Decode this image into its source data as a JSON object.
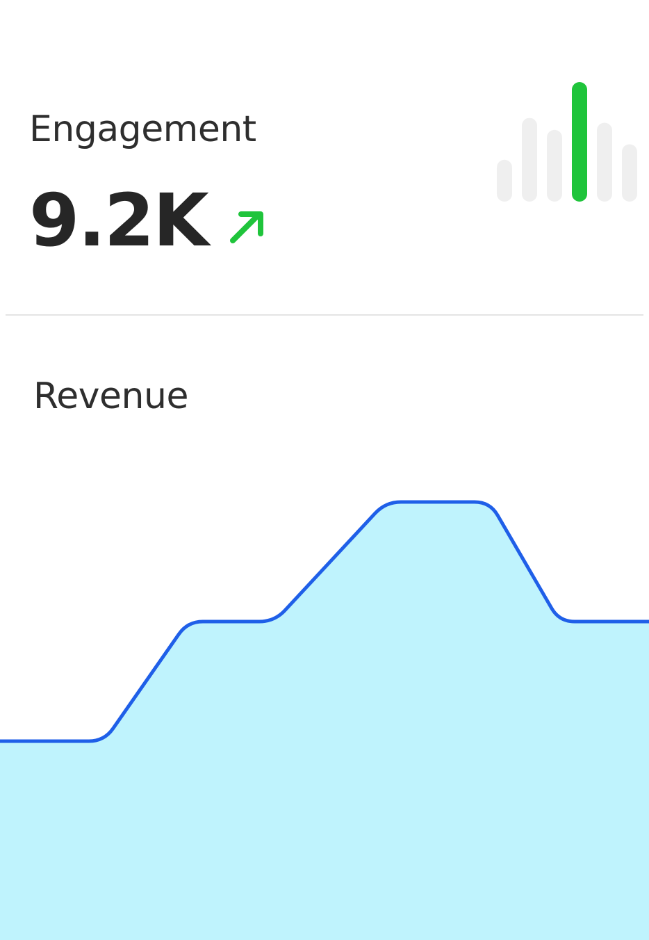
{
  "engagement": {
    "label": "Engagement",
    "value": "9.2K",
    "trend_icon": "arrow-up-right-icon",
    "trend_color": "#1fc43b"
  },
  "sparkline": {
    "bars": [
      0.35,
      0.7,
      0.6,
      1.0,
      0.66,
      0.48
    ],
    "highlight_index": 3,
    "base_color": "#efefef",
    "highlight_color": "#1fc43b"
  },
  "revenue": {
    "label": "Revenue",
    "line_color": "#1f5fe8",
    "fill_color": "#bff3fd"
  },
  "chart_data": {
    "type": "area",
    "title": "Revenue",
    "x": [
      0,
      1,
      2,
      3,
      4,
      5,
      6,
      7,
      8
    ],
    "values": [
      1,
      1,
      2,
      2,
      3,
      3,
      2,
      2,
      2
    ],
    "ylim": [
      0,
      4.2
    ],
    "grid": false,
    "xlabel": "",
    "ylabel": ""
  }
}
